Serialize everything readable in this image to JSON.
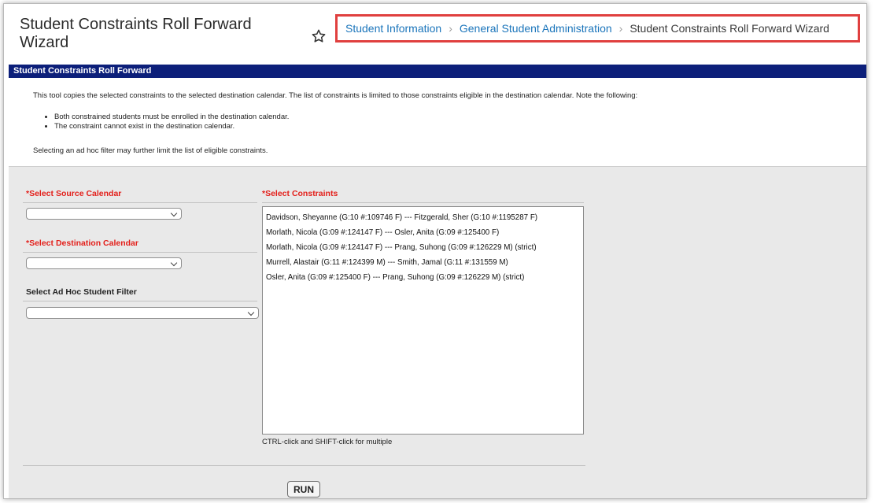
{
  "page": {
    "title": "Student Constraints Roll Forward Wizard",
    "breadcrumb": {
      "items": [
        "Student Information",
        "General Student Administration"
      ],
      "current": "Student Constraints Roll Forward Wizard"
    }
  },
  "section": {
    "title": "Student Constraints Roll Forward"
  },
  "info": {
    "intro": "This tool copies the selected constraints to the selected destination calendar. The list of constraints is limited to those constraints eligible in the destination calendar. Note the following:",
    "bullets": [
      "Both constrained students must be enrolled in the destination calendar.",
      "The constraint cannot exist in the destination calendar."
    ],
    "footer": "Selecting an ad hoc filter may further limit the list of eligible constraints."
  },
  "form": {
    "source_label": "*Select Source Calendar",
    "source_value": "",
    "destination_label": "*Select Destination Calendar",
    "destination_value": "",
    "filter_label": "Select Ad Hoc Student Filter",
    "filter_value": "",
    "constraints_label": "*Select Constraints",
    "constraints": [
      "Davidson, Sheyanne (G:10 #:109746 F) --- Fitzgerald, Sher (G:10 #:1195287 F)",
      "Morlath, Nicola (G:09 #:124147 F) --- Osler, Anita (G:09 #:125400 F)",
      "Morlath, Nicola (G:09 #:124147 F) --- Prang, Suhong (G:09 #:126229 M) (strict)",
      "Murrell, Alastair (G:11 #:124399 M) --- Smith, Jamal (G:11 #:131559 M)",
      "Osler, Anita (G:09 #:125400 F) --- Prang, Suhong (G:09 #:126229 M) (strict)"
    ],
    "hint": "CTRL-click and SHIFT-click for multiple",
    "run_label": "RUN"
  },
  "colors": {
    "section_bar": "#0c1f7a",
    "breadcrumb_link": "#1b75bb",
    "required_label": "#e3201b",
    "highlight_border": "#e0403f",
    "form_background": "#e9e9e9"
  },
  "icons": {
    "favorite": "star-outline-icon",
    "breadcrumb_separator": "chevron-right-icon",
    "select_arrow": "chevron-down-icon"
  }
}
